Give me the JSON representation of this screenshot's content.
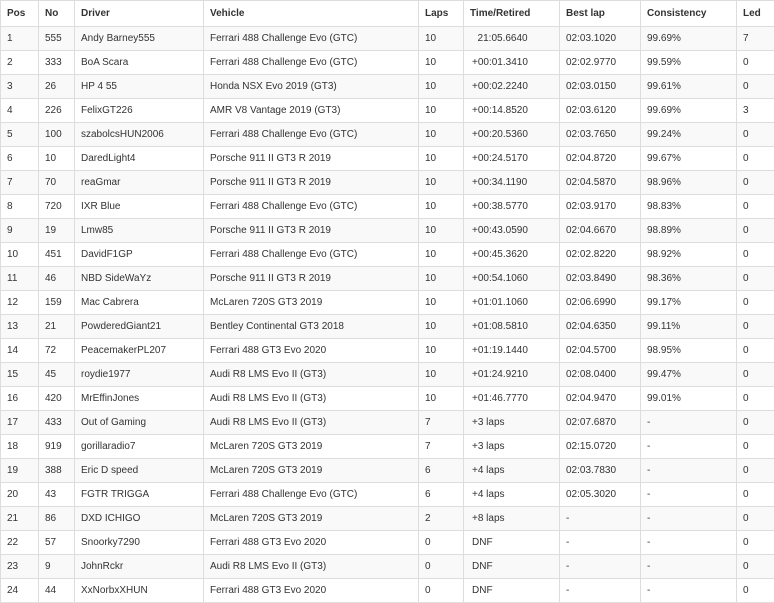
{
  "table": {
    "headers": [
      "Pos",
      "No",
      "Driver",
      "Vehicle",
      "Laps",
      "Time/Retired",
      "Best lap",
      "Consistency",
      "Led"
    ],
    "rows": [
      [
        "1",
        "555",
        "Andy Barney555",
        "Ferrari 488 Challenge Evo (GTC)",
        "10",
        "  21:05.6640",
        "02:03.1020",
        "99.69%",
        "7"
      ],
      [
        "2",
        "333",
        "BoA Scara",
        "Ferrari 488 Challenge Evo (GTC)",
        "10",
        "+00:01.3410",
        "02:02.9770",
        "99.59%",
        "0"
      ],
      [
        "3",
        "26",
        "HP 4 55",
        "Honda NSX Evo 2019 (GT3)",
        "10",
        "+00:02.2240",
        "02:03.0150",
        "99.61%",
        "0"
      ],
      [
        "4",
        "226",
        "FelixGT226",
        "AMR V8 Vantage 2019 (GT3)",
        "10",
        "+00:14.8520",
        "02:03.6120",
        "99.69%",
        "3"
      ],
      [
        "5",
        "100",
        "szabolcsHUN2006",
        "Ferrari 488 Challenge Evo (GTC)",
        "10",
        "+00:20.5360",
        "02:03.7650",
        "99.24%",
        "0"
      ],
      [
        "6",
        "10",
        "DaredLight4",
        "Porsche 911 II GT3 R 2019",
        "10",
        "+00:24.5170",
        "02:04.8720",
        "99.67%",
        "0"
      ],
      [
        "7",
        "70",
        "reaGmar",
        "Porsche 911 II GT3 R 2019",
        "10",
        "+00:34.1190",
        "02:04.5870",
        "98.96%",
        "0"
      ],
      [
        "8",
        "720",
        "IXR Blue",
        "Ferrari 488 Challenge Evo (GTC)",
        "10",
        "+00:38.5770",
        "02:03.9170",
        "98.83%",
        "0"
      ],
      [
        "9",
        "19",
        "Lmw85",
        "Porsche 911 II GT3 R 2019",
        "10",
        "+00:43.0590",
        "02:04.6670",
        "98.89%",
        "0"
      ],
      [
        "10",
        "451",
        "DavidF1GP",
        "Ferrari 488 Challenge Evo (GTC)",
        "10",
        "+00:45.3620",
        "02:02.8220",
        "98.92%",
        "0"
      ],
      [
        "11",
        "46",
        "NBD SideWaYz",
        "Porsche 911 II GT3 R 2019",
        "10",
        "+00:54.1060",
        "02:03.8490",
        "98.36%",
        "0"
      ],
      [
        "12",
        "159",
        "Mac Cabrera",
        "McLaren 720S GT3 2019",
        "10",
        "+01:01.1060",
        "02:06.6990",
        "99.17%",
        "0"
      ],
      [
        "13",
        "21",
        "PowderedGiant21",
        "Bentley Continental GT3 2018",
        "10",
        "+01:08.5810",
        "02:04.6350",
        "99.11%",
        "0"
      ],
      [
        "14",
        "72",
        "PeacemakerPL207",
        "Ferrari 488 GT3 Evo 2020",
        "10",
        "+01:19.1440",
        "02:04.5700",
        "98.95%",
        "0"
      ],
      [
        "15",
        "45",
        "roydie1977",
        "Audi R8 LMS Evo II (GT3)",
        "10",
        "+01:24.9210",
        "02:08.0400",
        "99.47%",
        "0"
      ],
      [
        "16",
        "420",
        "MrEffinJones",
        "Audi R8 LMS Evo II (GT3)",
        "10",
        "+01:46.7770",
        "02:04.9470",
        "99.01%",
        "0"
      ],
      [
        "17",
        "433",
        "Out of Gaming",
        "Audi R8 LMS Evo II (GT3)",
        "7",
        "+3 laps",
        "02:07.6870",
        "-",
        "0"
      ],
      [
        "18",
        "919",
        "gorillaradio7",
        "McLaren 720S GT3 2019",
        "7",
        "+3 laps",
        "02:15.0720",
        "-",
        "0"
      ],
      [
        "19",
        "388",
        "Eric D speed",
        "McLaren 720S GT3 2019",
        "6",
        "+4 laps",
        "02:03.7830",
        "-",
        "0"
      ],
      [
        "20",
        "43",
        "FGTR TRIGGA",
        "Ferrari 488 Challenge Evo (GTC)",
        "6",
        "+4 laps",
        "02:05.3020",
        "-",
        "0"
      ],
      [
        "21",
        "86",
        "DXD ICHIGO",
        "McLaren 720S GT3 2019",
        "2",
        "+8 laps",
        "-",
        "-",
        "0"
      ],
      [
        "22",
        "57",
        "Snoorky7290",
        "Ferrari 488 GT3 Evo 2020",
        "0",
        "DNF",
        "-",
        "-",
        "0"
      ],
      [
        "23",
        "9",
        "JohnRckr",
        "Audi R8 LMS Evo II (GT3)",
        "0",
        "DNF",
        "-",
        "-",
        "0"
      ],
      [
        "24",
        "44",
        "XxNorbxXHUN",
        "Ferrari 488 GT3 Evo 2020",
        "0",
        "DNF",
        "-",
        "-",
        "0"
      ]
    ]
  }
}
